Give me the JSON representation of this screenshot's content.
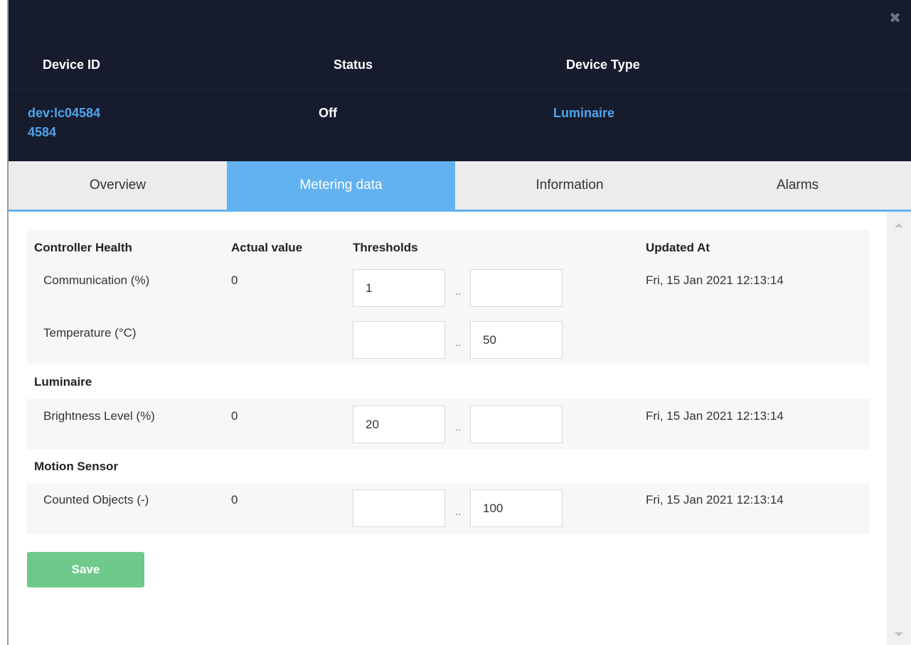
{
  "header": {
    "close_icon": "close-icon",
    "columns": {
      "device_id": "Device ID",
      "status": "Status",
      "device_type": "Device Type"
    },
    "values": {
      "device_id_line1": "dev:lc04584",
      "device_id_line2": "4584",
      "status": "Off",
      "device_type": "Luminaire"
    }
  },
  "tabs": [
    {
      "label": "Overview"
    },
    {
      "label": "Metering data",
      "active": true
    },
    {
      "label": "Information"
    },
    {
      "label": "Alarms"
    }
  ],
  "table": {
    "headers": {
      "name": "Controller Health",
      "actual": "Actual value",
      "thresholds": "Thresholds",
      "updated": "Updated At"
    },
    "rows": {
      "communication": {
        "label": "Communication (%)",
        "actual": "0",
        "min": "1",
        "max": "",
        "updated": "Fri, 15 Jan 2021 12:13:14"
      },
      "temperature": {
        "label": "Temperature (°C)",
        "actual": "",
        "min": "",
        "max": "50",
        "updated": ""
      },
      "brightness": {
        "label": "Brightness Level (%)",
        "actual": "0",
        "min": "20",
        "max": "",
        "updated": "Fri, 15 Jan 2021 12:13:14"
      },
      "counted": {
        "label": "Counted Objects (-)",
        "actual": "0",
        "min": "",
        "max": "100",
        "updated": "Fri, 15 Jan 2021 12:13:14"
      }
    },
    "sections": {
      "luminaire": "Luminaire",
      "motion": "Motion Sensor"
    },
    "range_separator": ".."
  },
  "actions": {
    "save": "Save"
  },
  "colors": {
    "header_bg": "#161b2e",
    "accent": "#62b2f0",
    "link": "#4ea5ea",
    "save": "#6ec98a"
  }
}
